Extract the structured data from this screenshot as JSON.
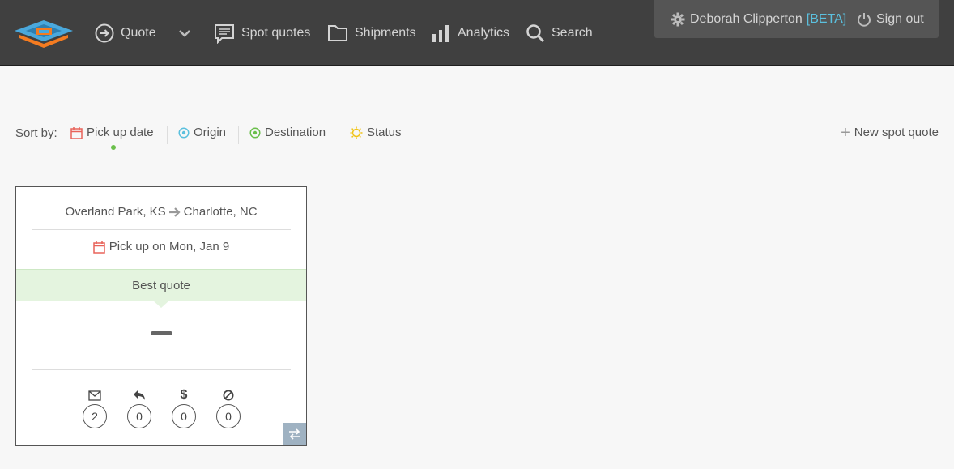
{
  "nav": {
    "quote": "Quote",
    "spot_quotes": "Spot quotes",
    "shipments": "Shipments",
    "analytics": "Analytics",
    "search": "Search"
  },
  "user": {
    "name": "Deborah Clipperton",
    "badge": "[BETA]",
    "sign_out": "Sign out"
  },
  "sort": {
    "label": "Sort by:",
    "options": [
      "Pick up date",
      "Origin",
      "Destination",
      "Status"
    ],
    "active": "Pick up date",
    "new_spot_quote": "New spot quote"
  },
  "card": {
    "origin": "Overland Park, KS",
    "destination": "Charlotte, NC",
    "pickup": "Pick up on Mon, Jan 9",
    "best_label": "Best quote",
    "stats": [
      {
        "icon": "envelope-icon",
        "count": "2"
      },
      {
        "icon": "reply-icon",
        "count": "0"
      },
      {
        "icon": "dollar-icon",
        "count": "0"
      },
      {
        "icon": "cancel-icon",
        "count": "0"
      }
    ]
  },
  "colors": {
    "topbar": "#404040",
    "user_box": "#555555",
    "beta": "#5bc0de",
    "best_band": "#e4f4df",
    "calendar": "#e8635a",
    "origin": "#5bc0de",
    "destination": "#6abf4b",
    "status": "#f0c419",
    "logo_blue": "#4aa8dc",
    "logo_orange": "#f47b20"
  }
}
